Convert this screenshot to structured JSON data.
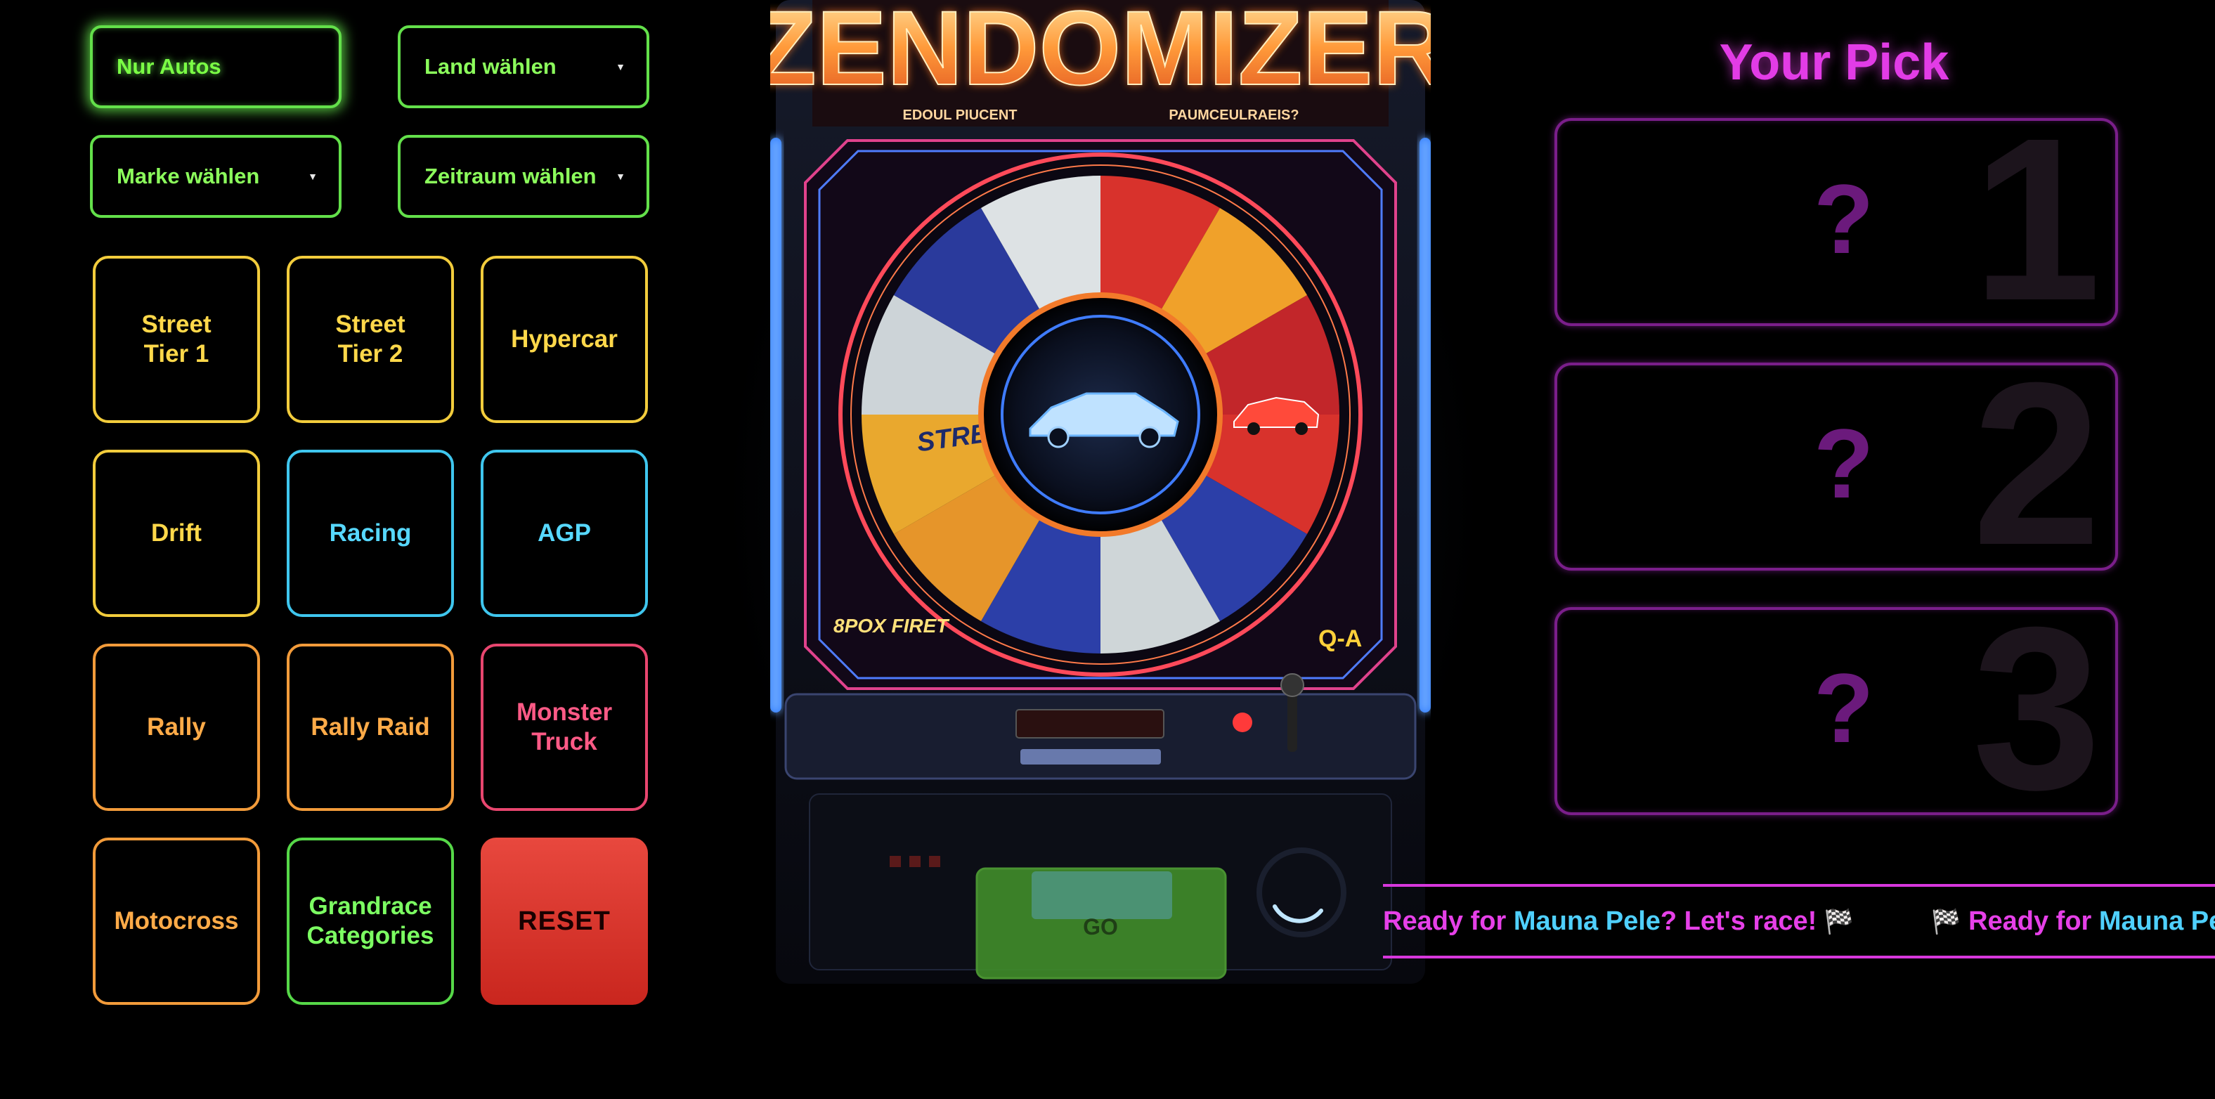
{
  "filters": {
    "only_cars": "Nur Autos",
    "country": "Land wählen",
    "brand": "Marke wählen",
    "period": "Zeitraum wählen"
  },
  "categories": [
    {
      "label": "Street Tier 1",
      "line1": "Street",
      "line2": "Tier 1",
      "color": "#f2cc3c"
    },
    {
      "label": "Street Tier 2",
      "line1": "Street",
      "line2": "Tier 2",
      "color": "#f2cc3c"
    },
    {
      "label": "Hypercar",
      "color": "#f2cc3c"
    },
    {
      "label": "Drift",
      "color": "#f2cc3c"
    },
    {
      "label": "Racing",
      "color": "#3fc6ee"
    },
    {
      "label": "AGP",
      "color": "#3fc6ee"
    },
    {
      "label": "Rally",
      "color": "#f29b3a"
    },
    {
      "label": "Rally Raid",
      "color": "#f29b3a"
    },
    {
      "label": "Monster Truck",
      "line1": "Monster",
      "line2": "Truck",
      "color": "#e8466f"
    },
    {
      "label": "Motocross",
      "color": "#f29b3a"
    },
    {
      "label": "Grandrace Categories",
      "line1": "Grandrace",
      "line2": "Categories",
      "color": "#56d848"
    },
    {
      "label": "RESET",
      "color": "#e8483e"
    }
  ],
  "machine": {
    "title": "ZENDOMIZER",
    "subtitle_left": "EDOUL PIUCENT",
    "subtitle_right": "PAUMCEULRAEIS?",
    "wheel_segment_highlight": "STREET TIER 1",
    "go_label": "GO",
    "corner_left": "8POX FIRET",
    "corner_right": "Q-A"
  },
  "pick": {
    "title": "Your Pick",
    "slots": [
      {
        "placeholder": "?",
        "number": "1"
      },
      {
        "placeholder": "?",
        "number": "2"
      },
      {
        "placeholder": "?",
        "number": "3"
      }
    ]
  },
  "ticker": {
    "pre": "Ready for ",
    "highlight": "Mauna Pele",
    "post": "? Let's race! ",
    "flag": "🏁"
  },
  "colors": {
    "neon_green": "#63e04a",
    "neon_magenta": "#e23ce6",
    "neon_cyan": "#4fd0ff",
    "reset_red": "#e8483e"
  }
}
